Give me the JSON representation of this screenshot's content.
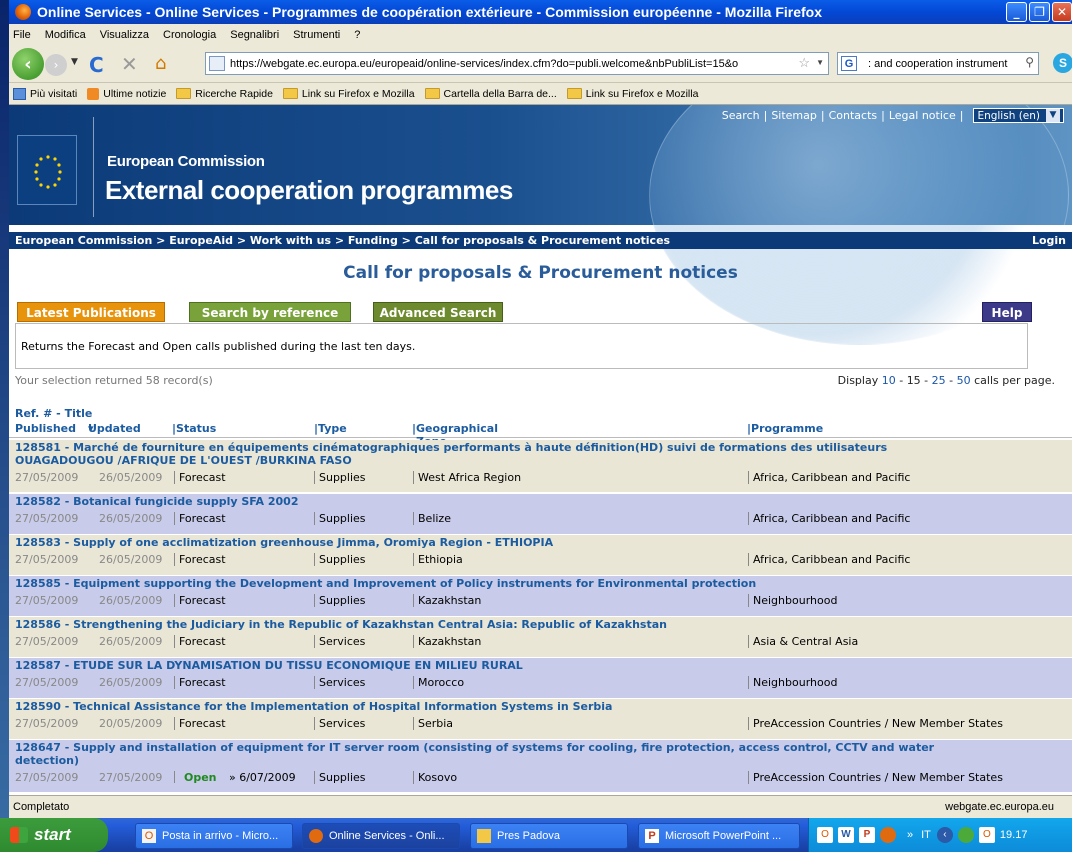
{
  "window": {
    "title": "Online Services - Online Services - Programmes de coopération extérieure - Commission européenne - Mozilla Firefox"
  },
  "menu": [
    "File",
    "Modifica",
    "Visualizza",
    "Cronologia",
    "Segnalibri",
    "Strumenti",
    "?"
  ],
  "nav": {
    "url": "https://webgate.ec.europa.eu/europeaid/online-services/index.cfm?do=publi.welcome&nbPubliList=15&o",
    "search_value": ": and cooperation instrument"
  },
  "bookmarks": [
    "Più visitati",
    "Ultime notizie",
    "Ricerche Rapide",
    "Link su Firefox e Mozilla",
    "Cartella della Barra de...",
    "Link su Firefox e Mozilla"
  ],
  "site": {
    "top_links": [
      "Search",
      "Sitemap",
      "Contacts",
      "Legal notice"
    ],
    "language": "English (en)",
    "org": "European Commission",
    "title": "External cooperation programmes",
    "breadcrumb": "European Commission > EuropeAid > Work with us > Funding > Call for proposals & Procurement notices",
    "login": "Login",
    "page_title": "Call for proposals & Procurement notices",
    "tabs": {
      "latest": "Latest Publications",
      "reference": "Search by reference",
      "advanced": "Advanced Search",
      "help": "Help"
    },
    "description": "Returns the Forecast and Open calls published during the last ten days.",
    "selection": "Your selection returned 58 record(s)",
    "display": {
      "prefix": "Display",
      "o1": "10",
      "o2": "15",
      "o3": "25",
      "o4": "50",
      "suffix": "calls per page."
    },
    "columns": {
      "ref": "Ref. # - Title",
      "published": "Published",
      "updated": "Updated",
      "sort_icon": "▾",
      "status": "Status",
      "type": "Type",
      "zone": "Geographical Zone",
      "programme": "Programme"
    }
  },
  "rows": [
    {
      "title": "128581 - Marché de fourniture en équipements cinématographiques performants à haute définition(HD) suivi de formations des utilisateurs",
      "title2": "OUAGADOUGOU /AFRIQUE DE L'OUEST /BURKINA FASO",
      "published": "27/05/2009",
      "updated": "26/05/2009",
      "status": "Forecast",
      "status_extra": "",
      "type": "Supplies",
      "zone": "West Africa Region",
      "programme": "Africa, Caribbean and Pacific"
    },
    {
      "title": "128582 - Botanical fungicide supply SFA 2002",
      "title2": "",
      "published": "27/05/2009",
      "updated": "26/05/2009",
      "status": "Forecast",
      "status_extra": "",
      "type": "Supplies",
      "zone": "Belize",
      "programme": "Africa, Caribbean and Pacific"
    },
    {
      "title": "128583 - Supply of one acclimatization greenhouse Jimma, Oromiya Region - ETHIOPIA",
      "title2": "",
      "published": "27/05/2009",
      "updated": "26/05/2009",
      "status": "Forecast",
      "status_extra": "",
      "type": "Supplies",
      "zone": "Ethiopia",
      "programme": "Africa, Caribbean and Pacific"
    },
    {
      "title": "128585 - Equipment supporting the Development and Improvement of Policy instruments for Environmental protection",
      "title2": "",
      "published": "27/05/2009",
      "updated": "26/05/2009",
      "status": "Forecast",
      "status_extra": "",
      "type": "Supplies",
      "zone": "Kazakhstan",
      "programme": "Neighbourhood"
    },
    {
      "title": "128586 - Strengthening the Judiciary in the Republic of Kazakhstan Central Asia: Republic of Kazakhstan",
      "title2": "",
      "published": "27/05/2009",
      "updated": "26/05/2009",
      "status": "Forecast",
      "status_extra": "",
      "type": "Services",
      "zone": "Kazakhstan",
      "programme": "Asia & Central Asia"
    },
    {
      "title": "128587 - ETUDE SUR LA DYNAMISATION DU TISSU ECONOMIQUE EN MILIEU RURAL",
      "title2": "",
      "published": "27/05/2009",
      "updated": "26/05/2009",
      "status": "Forecast",
      "status_extra": "",
      "type": "Services",
      "zone": "Morocco",
      "programme": "Neighbourhood"
    },
    {
      "title": "128590 - Technical Assistance for the Implementation of Hospital Information Systems in Serbia",
      "title2": "",
      "published": "27/05/2009",
      "updated": "20/05/2009",
      "status": "Forecast",
      "status_extra": "",
      "type": "Services",
      "zone": "Serbia",
      "programme": "PreAccession Countries / New Member States"
    },
    {
      "title": "128647 - Supply and installation of equipment for IT server room (consisting of systems for cooling, fire protection, access control, CCTV and water",
      "title2": "detection)",
      "published": "27/05/2009",
      "updated": "27/05/2009",
      "status": "Open",
      "status_extra": "» 6/07/2009",
      "type": "Supplies",
      "zone": "Kosovo",
      "programme": "PreAccession Countries / New Member States"
    }
  ],
  "status_bar": {
    "left": "Completato",
    "right": "webgate.ec.europa.eu"
  },
  "taskbar": {
    "start": "start",
    "items": [
      "Posta in arrivo - Micro...",
      "Online Services - Onli...",
      "Pres Padova",
      "Microsoft PowerPoint ..."
    ],
    "lang": "IT",
    "time": "19.17"
  }
}
